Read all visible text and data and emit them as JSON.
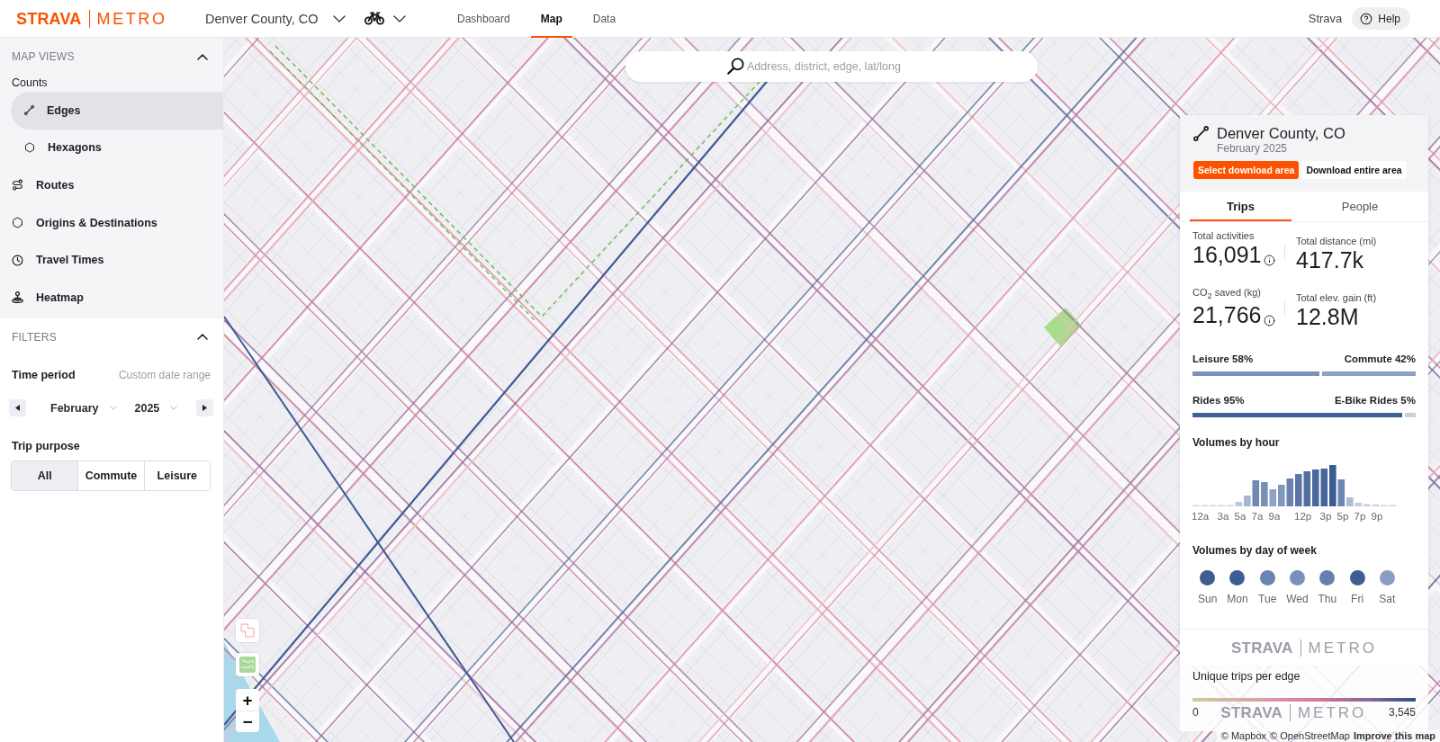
{
  "topbar": {
    "logo": {
      "brand": "STRAVA",
      "product": "METRO"
    },
    "location": "Denver County, CO",
    "nav": [
      {
        "label": "Dashboard",
        "selected": false
      },
      {
        "label": "Map",
        "selected": true
      },
      {
        "label": "Data",
        "selected": false
      }
    ],
    "account_link": "Strava",
    "help": "Help"
  },
  "sidebar": {
    "map_views": {
      "title": "MAP VIEWS",
      "expanded": true,
      "items": [
        {
          "kind": "group",
          "label": "Counts",
          "children": [
            {
              "label": "Edges",
              "selected": true
            },
            {
              "label": "Hexagons",
              "selected": false
            }
          ]
        },
        {
          "kind": "view",
          "label": "Routes",
          "selected": false
        },
        {
          "kind": "view",
          "label": "Origins & Destinations",
          "selected": false
        },
        {
          "kind": "view",
          "label": "Travel Times",
          "selected": false
        },
        {
          "kind": "view",
          "label": "Heatmap",
          "selected": false
        }
      ]
    },
    "filters": {
      "title": "FILTERS",
      "expanded": true,
      "time_period": {
        "label": "Time period",
        "custom_link": "Custom date range",
        "month": "February",
        "year": "2025"
      },
      "trip_purpose": {
        "label": "Trip purpose",
        "options": [
          {
            "label": "All",
            "selected": true
          },
          {
            "label": "Commute",
            "selected": false
          },
          {
            "label": "Leisure",
            "selected": false
          }
        ]
      }
    }
  },
  "map": {
    "search": {
      "placeholder": "Address, district, edge, lat/long"
    },
    "zoom_controls": [
      "+",
      "−"
    ],
    "stats_panel": {
      "title": "Denver County, CO",
      "subtitle": "February 2025",
      "actions": [
        {
          "label": "Select download area",
          "kind": "primary"
        },
        {
          "label": "Download entire area",
          "kind": "secondary"
        }
      ],
      "tabs": [
        {
          "label": "Trips",
          "selected": true
        },
        {
          "label": "People",
          "selected": false
        }
      ],
      "metrics": [
        {
          "label": "Total activities",
          "value": "16,091",
          "info": true
        },
        {
          "label": "Total distance (mi)",
          "value": "417.7k",
          "info": false
        },
        {
          "label": "CO$_{2}$ saved (kg)",
          "value": "21,766",
          "info": true
        },
        {
          "label": "Total elev. gain (ft)",
          "value": "12.8M",
          "info": false
        }
      ],
      "splits": [
        {
          "left": "Leisure 58%",
          "right": "Commute 42%",
          "level": 0.58
        },
        {
          "left": "Rides 95%",
          "right": "E-Bike Rides 5%",
          "level": 0.95
        }
      ],
      "hour_chart": {
        "title": "Volumes by hour",
        "labels": [
          "12a",
          "3a",
          "5a",
          "7a",
          "9a",
          "12p",
          "3p",
          "5p",
          "7p",
          "9p"
        ]
      },
      "day_chart": {
        "title": "Volumes by day of week",
        "days": [
          {
            "label": "Sun",
            "color": "#3e5d92"
          },
          {
            "label": "Mon",
            "color": "#3e5d92"
          },
          {
            "label": "Tue",
            "color": "#6a83b0"
          },
          {
            "label": "Wed",
            "color": "#7990b9"
          },
          {
            "label": "Thu",
            "color": "#6680ae"
          },
          {
            "label": "Fri",
            "color": "#3e5d92"
          },
          {
            "label": "Sat",
            "color": "#8a9ec4"
          }
        ]
      },
      "footer_logo": {
        "brand": "STRAVA",
        "product": "METRO"
      }
    },
    "legend": {
      "title": "Unique trips per edge",
      "min": "0",
      "max": "3,545",
      "logo": {
        "brand": "STRAVA",
        "product": "METRO"
      }
    },
    "attribution": {
      "links": [
        "© Mapbox",
        "© OpenStreetMap"
      ],
      "improve_link": "Improve this map"
    }
  }
}
